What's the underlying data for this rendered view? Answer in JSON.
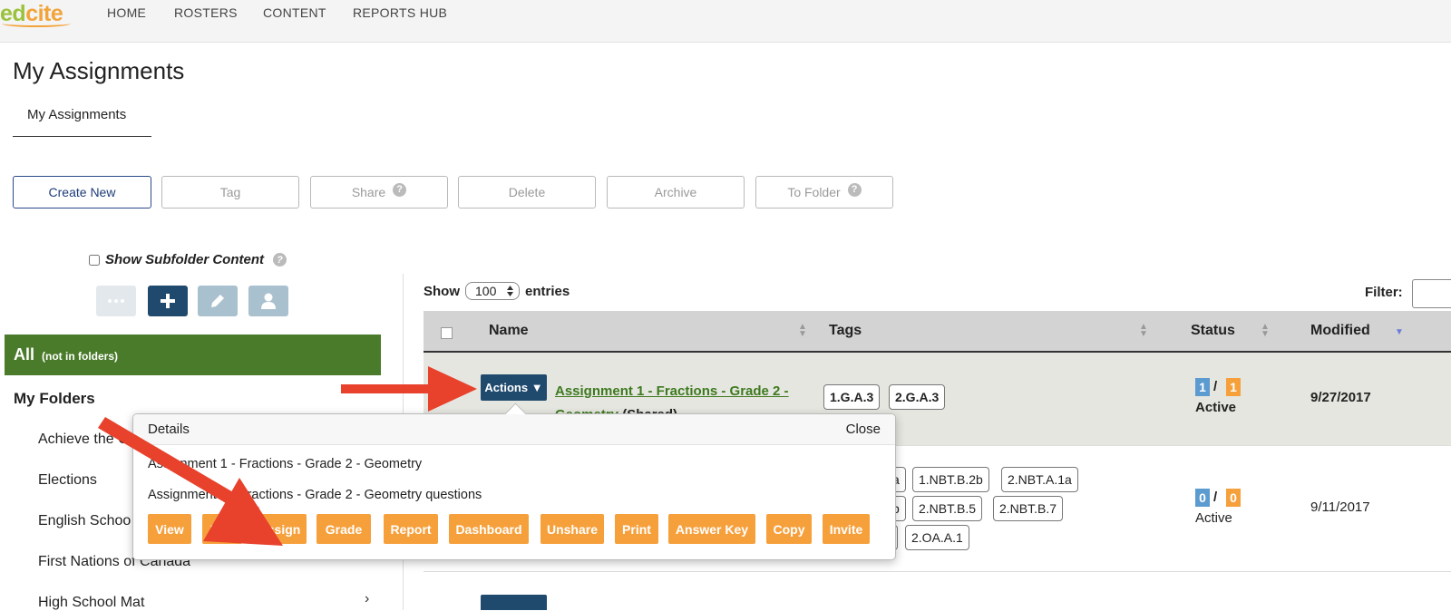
{
  "app": {
    "logo_part1": "ed",
    "logo_part2": "cite"
  },
  "nav": [
    "HOME",
    "ROSTERS",
    "CONTENT",
    "REPORTS HUB"
  ],
  "page_title": "My Assignments",
  "tab_label": "My Assignments",
  "toolbar": {
    "create_new": "Create New",
    "tag": "Tag",
    "share": "Share",
    "delete": "Delete",
    "archive": "Archive",
    "to_folder": "To Folder",
    "help_glyph": "?"
  },
  "sidebar": {
    "show_subfolder_label": "Show Subfolder Content",
    "all_label": "All",
    "all_sub": "(not in folders)",
    "my_folders": "My Folders",
    "folders": [
      "Achieve the Co",
      "Elections",
      "English Schoo",
      "First Nations of Canada",
      "High School Mat"
    ]
  },
  "table": {
    "show_label": "Show",
    "entries_value": "100",
    "entries_label": "entries",
    "filter_label": "Filter:",
    "headers": {
      "name": "Name",
      "tags": "Tags",
      "status": "Status",
      "modified": "Modified"
    },
    "actions_label": "Actions ▼",
    "row1": {
      "name": "Assignment 1 - Fractions - Grade 2 - Geometry",
      "shared": " (Shared)",
      "tags": [
        "1.G.A.3",
        "2.G.A.3"
      ],
      "status_a": "1",
      "status_b": "1",
      "status_slash": "/",
      "status_text": "Active",
      "modified": "9/27/2017"
    },
    "row2": {
      "tags": [
        "a",
        "1.NBT.B.2b",
        "2.NBT.A.1a",
        "b",
        "2.NBT.B.5",
        "2.NBT.B.7",
        "2.OA.A.1"
      ],
      "status_a": "0",
      "status_b": "0",
      "status_slash": "/",
      "status_text": "Active",
      "modified": "9/11/2017"
    }
  },
  "popover": {
    "title": "Details",
    "close": "Close",
    "line1": "Assignment 1 - Fractions - Grade 2 - Geometry",
    "line2": "Assignment 1 - Fractions - Grade 2 - Geometry questions",
    "buttons": [
      "View",
      "Edit",
      "Assign",
      "Grade",
      "Report",
      "Dashboard",
      "Unshare",
      "Print",
      "Answer Key",
      "Copy",
      "Invite"
    ]
  },
  "colors": {
    "nav_bg": "#f4f4f4",
    "all_green": "#4a7b2a",
    "actions_navy": "#1f4a6e",
    "action_orange": "#f6a03c",
    "status_blue": "#5b9bd0",
    "status_orange": "#f6a03c",
    "arrow_red": "#e8412c"
  }
}
